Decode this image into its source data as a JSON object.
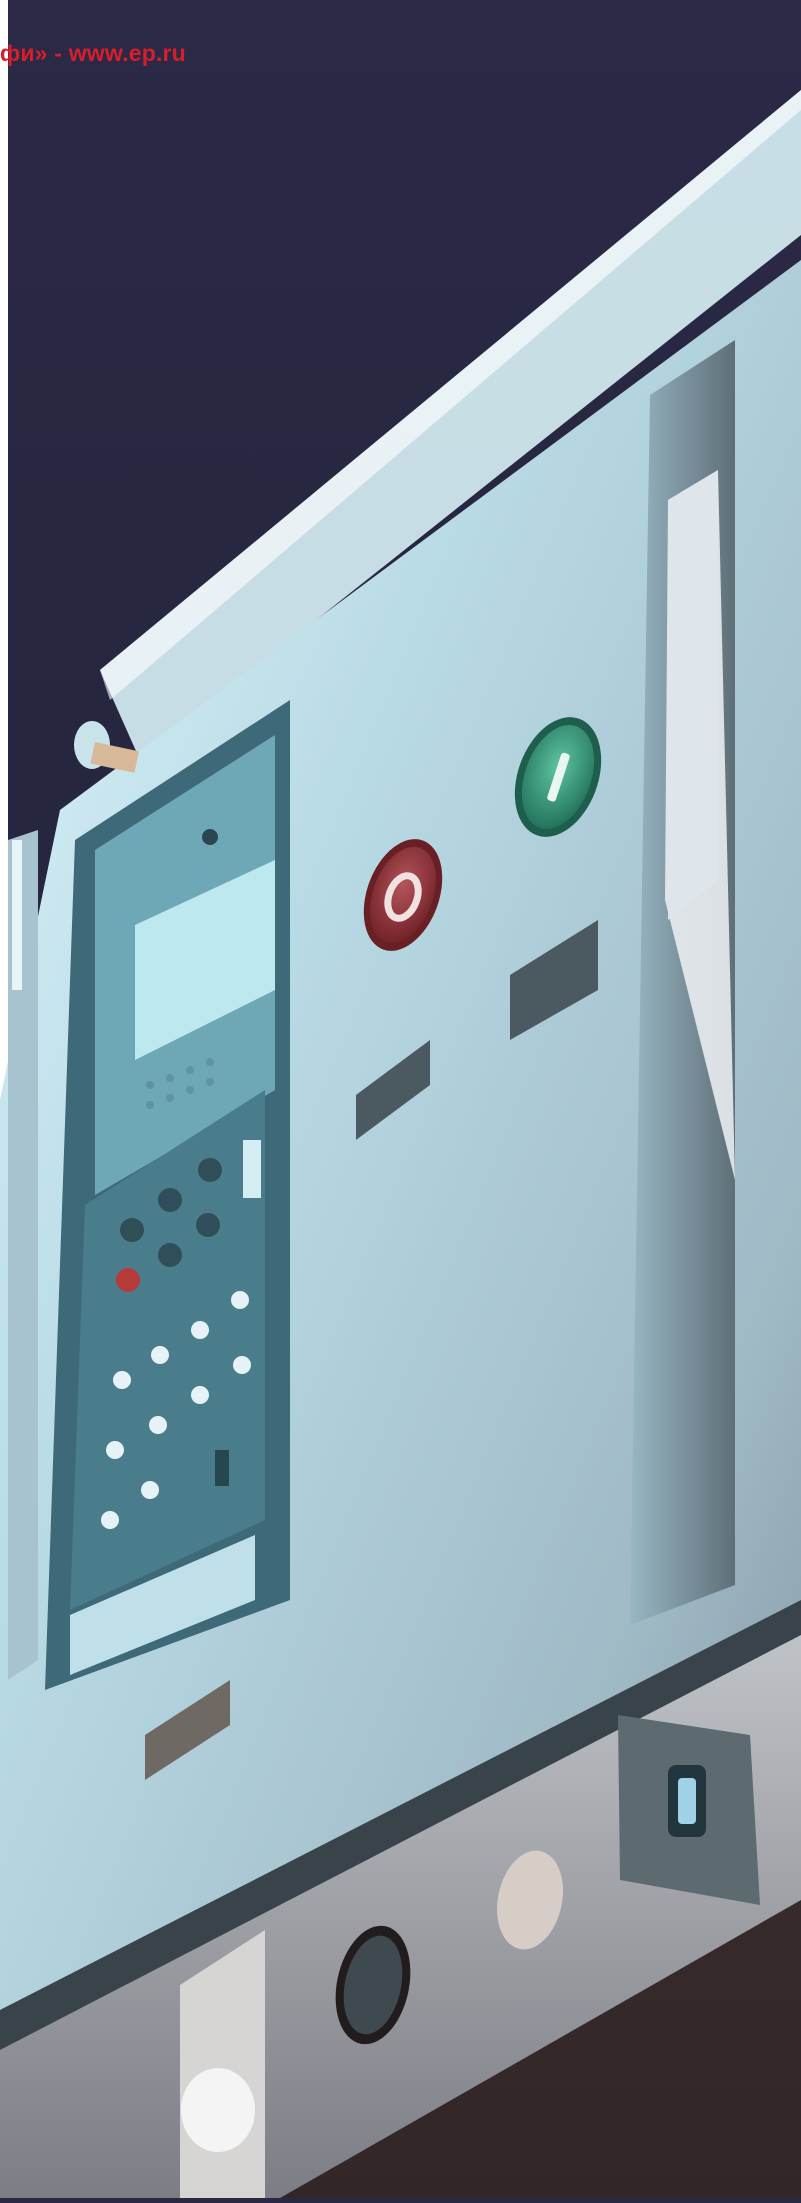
{
  "watermark": {
    "text": "фи» - www.ep.ru"
  },
  "photo": {
    "colors": {
      "background": "#2a2845",
      "panel": "#bfdce6",
      "panel_shadow": "#8fb4c2",
      "keypad": "#4f7f8e",
      "display": "#b9e7ef",
      "open_button": "#8a2f34",
      "close_button": "#2f8b73"
    },
    "buttons": {
      "open_symbol": "O",
      "close_symbol": "I"
    }
  }
}
